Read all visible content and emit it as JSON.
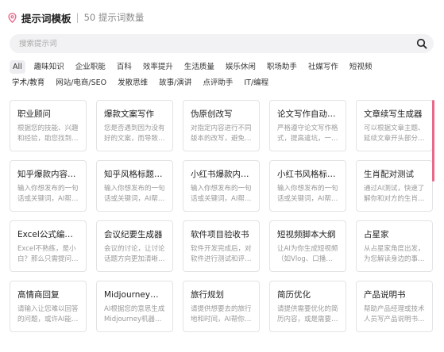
{
  "header": {
    "title": "提示词模板",
    "separator": "|",
    "count": "50 提示词数量"
  },
  "search": {
    "placeholder": "搜索提示词",
    "value": ""
  },
  "tags": [
    "All",
    "趣味知识",
    "企业职能",
    "百科",
    "效率提升",
    "生活质量",
    "娱乐休闲",
    "职场助手",
    "社媒写作",
    "短视频",
    "学术/教育",
    "网站/电商/SEO",
    "发散思维",
    "故事/演讲",
    "点评助手",
    "IT/编程"
  ],
  "active_tag": "All",
  "cards": [
    {
      "title": "职业顾问",
      "desc": "根据您的技能、兴趣和经验，助您找到适合…"
    },
    {
      "title": "爆款文案写作",
      "desc": "您是否遇到因为没有好的文案，而导致很多…"
    },
    {
      "title": "伪原创改写",
      "desc": "对指定内容进行不同版本的改写，避免文本…"
    },
    {
      "title": "论文写作自动生…",
      "desc": "严格遵守论文写作格式，提高遣坑，一份…"
    },
    {
      "title": "文章续写生成器",
      "desc": "可以根据文章主题、延续文章开头部分完成…"
    },
    {
      "title": "知乎爆款内容生…",
      "desc": "输入你想发布的一句话或关键词，AI帮你生…"
    },
    {
      "title": "知乎风格标题生…",
      "desc": "输入你想发布的一句话或关键词，AI帮你生…"
    },
    {
      "title": "小红书爆款内容…",
      "desc": "输入你想发布的一句话或关键词，AI帮你生…"
    },
    {
      "title": "小红书风格标题…",
      "desc": "输入你想发布的一句话或关键词，AI帮你生…"
    },
    {
      "title": "生肖配对测试",
      "desc": "通过AI测试，快速了解你和对方的生肖是否…"
    },
    {
      "title": "Excel公式编辑器",
      "desc": "Excel不熟练，是小白？那么只需提问想…"
    },
    {
      "title": "会议纪要生成器",
      "desc": "会议的讨论，让讨论话题方向更加清晰明确…"
    },
    {
      "title": "软件项目验收书",
      "desc": "软件开发完成后，对软件进行测试和评估，…"
    },
    {
      "title": "短视频脚本大纲",
      "desc": "让AI为你生成短视频（如Vlog、口播稿）…"
    },
    {
      "title": "占星家",
      "desc": "从占星家角度出发，为您解读身边的事情，…"
    },
    {
      "title": "高情商回复",
      "desc": "请输入让您难以回答的问题，或许AI能为您…"
    },
    {
      "title": "Midjourney提示词",
      "desc": "AI根据您的意思生成Midjourney机器人生…"
    },
    {
      "title": "旅行规划",
      "desc": "请提供想要去的旅行地和时间，AI帮你规划…"
    },
    {
      "title": "简历优化",
      "desc": "请提供需要优化的简历内容，或是需要突出…"
    },
    {
      "title": "产品说明书",
      "desc": "帮助产品经理或技术人员写产品说明书，提…"
    }
  ],
  "colors": {
    "accent": "#e86a8a",
    "tag_active_bg": "#eeeef2",
    "card_border": "#e3e3e6",
    "search_bg": "#f2f2f4"
  }
}
